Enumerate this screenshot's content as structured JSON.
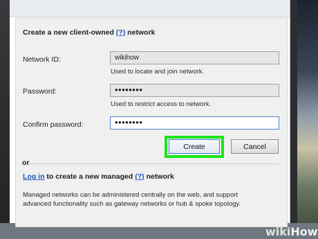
{
  "dialog": {
    "heading_prefix": "Create a new client-owned",
    "heading_help": "(?)",
    "heading_suffix": "network"
  },
  "form": {
    "network_id": {
      "label": "Network ID:",
      "value": "wikihow",
      "hint": "Used to locate and join network."
    },
    "password": {
      "label": "Password:",
      "value": "••••••••",
      "hint": "Used to restrict access to network."
    },
    "confirm_password": {
      "label": "Confirm password:",
      "value": "••••••••"
    }
  },
  "buttons": {
    "create": "Create",
    "cancel": "Cancel"
  },
  "or_label": "or",
  "managed": {
    "login_link": "Log in",
    "text_middle": "to create a new managed",
    "help": "(?)",
    "text_end": "network",
    "description_line1": "Managed networks can be administered centrally on the web, and support",
    "description_line2": "advanced functionality such as gateway networks or hub & spoke topology."
  },
  "watermark": {
    "wiki": "wiki",
    "how": "How"
  },
  "colors": {
    "highlight": "#19e619",
    "link": "#1a56b7",
    "focus_border": "#4f7fc4"
  }
}
